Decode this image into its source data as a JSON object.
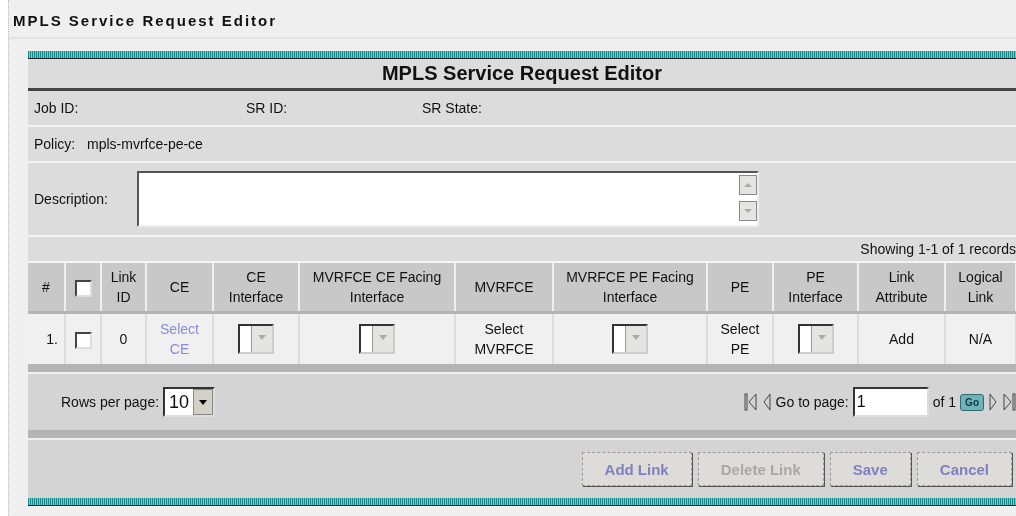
{
  "page_title": "MPLS Service Request Editor",
  "panel": {
    "title": "MPLS Service Request Editor"
  },
  "info": {
    "job_id_label": "Job ID:",
    "sr_id_label": "SR ID:",
    "sr_state_label": "SR State:",
    "policy_label": "Policy:",
    "policy_value": "mpls-mvrfce-pe-ce",
    "description_label": "Description:"
  },
  "table": {
    "records": "Showing 1-1 of 1 records",
    "columns": [
      {
        "kind": "text",
        "label": "#"
      },
      {
        "kind": "checkbox",
        "checked": false
      },
      {
        "kind": "text",
        "label": "Link ID"
      },
      {
        "kind": "text",
        "label": "CE"
      },
      {
        "kind": "text",
        "label": "CE Interface"
      },
      {
        "kind": "text",
        "label": "MVRFCE CE Facing Interface"
      },
      {
        "kind": "text",
        "label": "MVRFCE"
      },
      {
        "kind": "text",
        "label": "MVRFCE PE Facing Interface"
      },
      {
        "kind": "text",
        "label": "PE"
      },
      {
        "kind": "text",
        "label": "PE Interface"
      },
      {
        "kind": "text",
        "label": "Link Attribute"
      },
      {
        "kind": "text",
        "label": "Logical Link"
      }
    ],
    "rows": [
      {
        "cells": [
          {
            "kind": "number",
            "text": "1."
          },
          {
            "kind": "checkbox",
            "checked": false
          },
          {
            "kind": "text",
            "text": "0"
          },
          {
            "kind": "link",
            "text": "Select CE"
          },
          {
            "kind": "dropdown",
            "disabled": true
          },
          {
            "kind": "dropdown",
            "disabled": true
          },
          {
            "kind": "text",
            "text": "Select MVRFCE"
          },
          {
            "kind": "dropdown",
            "disabled": true
          },
          {
            "kind": "text",
            "text": "Select PE"
          },
          {
            "kind": "dropdown",
            "disabled": true
          },
          {
            "kind": "text",
            "text": "Add"
          },
          {
            "kind": "text",
            "text": "N/A"
          }
        ]
      }
    ]
  },
  "pagination": {
    "rows_per_page_label": "Rows per page:",
    "rows_per_page": "10",
    "go_to_label": "Go to page:",
    "page": "1",
    "of_pages": "of 1",
    "go_button": "Go"
  },
  "buttons": [
    {
      "label": "Add Link",
      "disabled": false
    },
    {
      "label": "Delete Link",
      "disabled": true
    },
    {
      "label": "Save",
      "disabled": false
    },
    {
      "label": "Cancel",
      "disabled": false
    }
  ]
}
